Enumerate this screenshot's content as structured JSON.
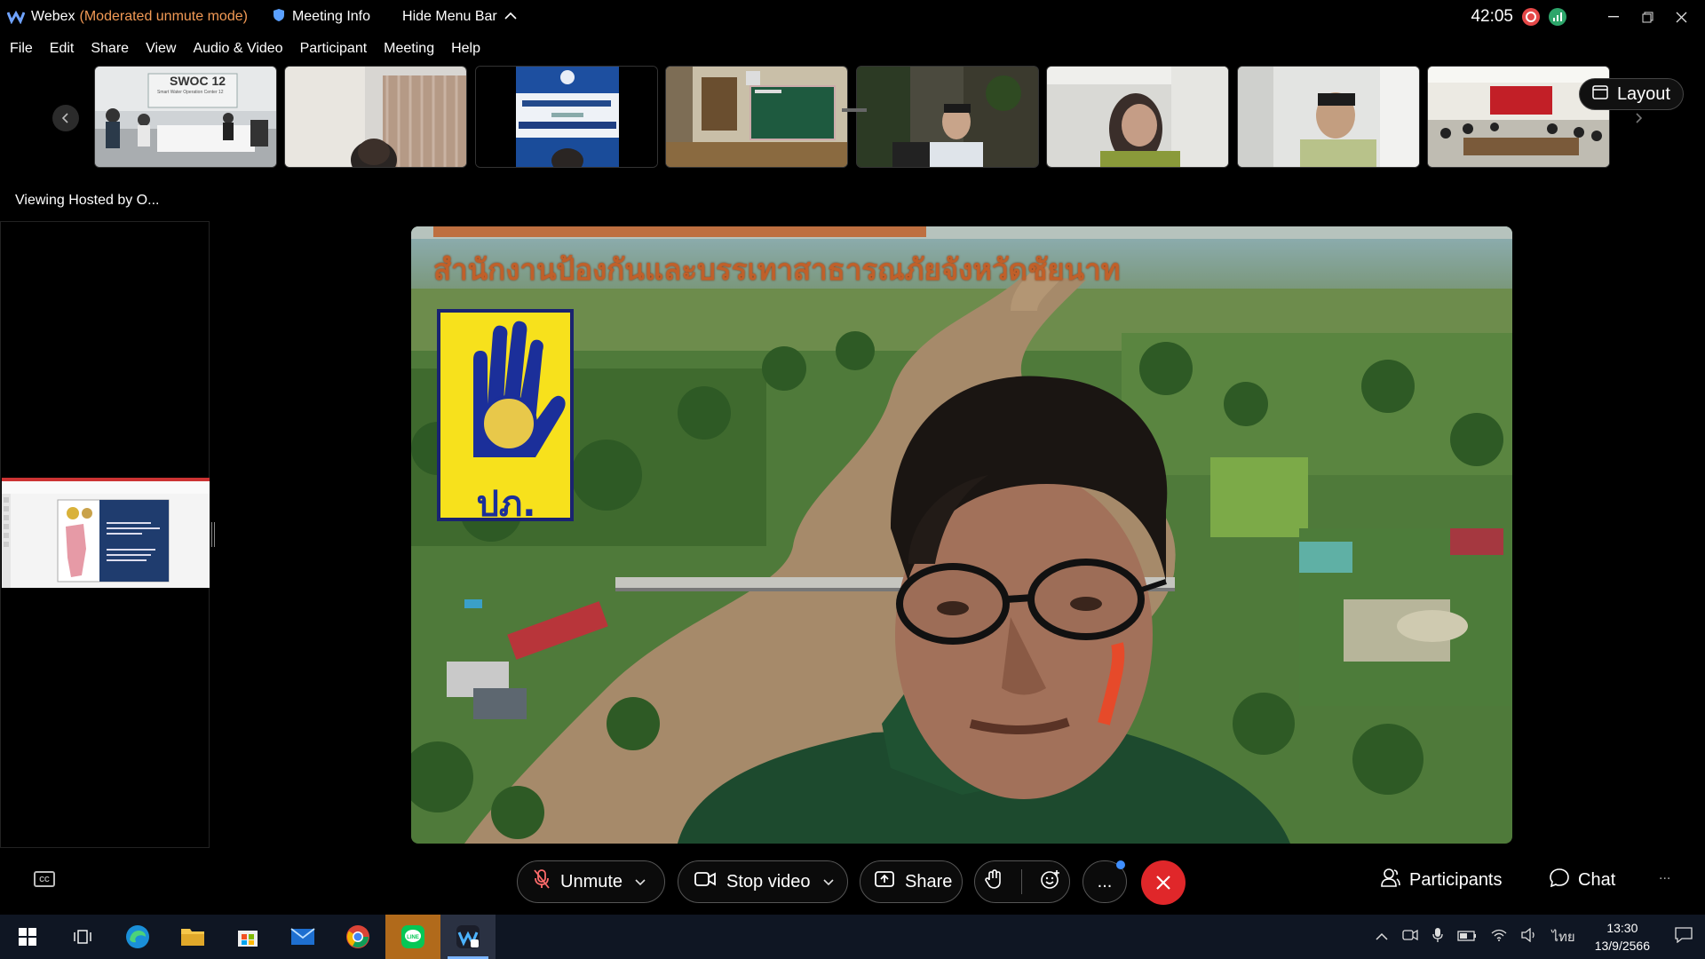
{
  "titlebar": {
    "app_name": "Webex",
    "mode": "(Moderated unmute mode)",
    "meeting_info": "Meeting Info",
    "hide_menu_bar": "Hide Menu Bar",
    "timer": "42:05",
    "colors": {
      "background": "#000000",
      "mode_text": "#f29a55",
      "recording": "#e54848",
      "network": "#2da56a"
    }
  },
  "menu": {
    "items": [
      "File",
      "Edit",
      "Share",
      "View",
      "Audio & Video",
      "Participant",
      "Meeting",
      "Help"
    ]
  },
  "strip": {
    "layout_label": "Layout",
    "thumbs": [
      {
        "sign": "SWOC 12",
        "sub": "Smart Water Operation Center 12"
      },
      {
        "sign": ""
      },
      {
        "sign": ""
      },
      {
        "sign": ""
      },
      {
        "sign": ""
      },
      {
        "sign": ""
      },
      {
        "sign": ""
      },
      {
        "sign": ""
      }
    ]
  },
  "viewing_label": "Viewing Hosted by O...",
  "main_video": {
    "banner_line2": "สำนักงานป้องกันและบรรเทาสาธารณภัยจังหวัดชัยนาท",
    "logo_text": "ปภ."
  },
  "controls": {
    "unmute_label": "Unmute",
    "stop_video_label": "Stop video",
    "share_label": "Share",
    "participants_label": "Participants",
    "chat_label": "Chat",
    "more_label": "...",
    "end_color": "#e0272a",
    "accent_color": "#3e8eff"
  },
  "taskbar": {
    "apps": [
      "windows-start-icon",
      "task-view-icon",
      "edge-icon",
      "file-explorer-icon",
      "microsoft-store-icon",
      "mail-icon",
      "chrome-icon",
      "line-icon",
      "webex-icon"
    ],
    "language": "ไทย",
    "time": "13:30",
    "date": "13/9/2566"
  }
}
